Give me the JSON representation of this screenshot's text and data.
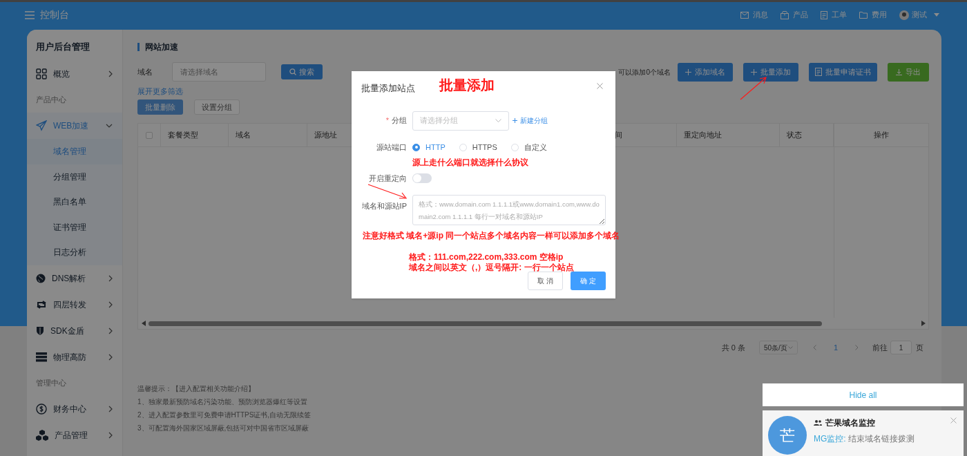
{
  "topbar": {
    "title": "控制台",
    "nav": [
      {
        "label": "消息"
      },
      {
        "label": "产品"
      },
      {
        "label": "工单"
      },
      {
        "label": "费用"
      }
    ],
    "user": "测试"
  },
  "sidebar": {
    "title": "用户后台管理",
    "items": [
      {
        "kind": "item",
        "label": "概览",
        "selected": false
      },
      {
        "kind": "section",
        "label": "产品中心"
      },
      {
        "kind": "item",
        "label": "WEB加速",
        "selected": false,
        "expanded": true,
        "children": [
          {
            "label": "域名管理",
            "selected": true
          },
          {
            "label": "分组管理",
            "selected": false
          },
          {
            "label": "黑白名单",
            "selected": false
          },
          {
            "label": "证书管理",
            "selected": false
          },
          {
            "label": "日志分析",
            "selected": false
          }
        ]
      },
      {
        "kind": "item",
        "label": "DNS解析",
        "selected": false,
        "expanded": false
      },
      {
        "kind": "item",
        "label": "四层转发",
        "selected": false,
        "expanded": false
      },
      {
        "kind": "item",
        "label": "SDK金盾",
        "selected": false,
        "expanded": false
      },
      {
        "kind": "item",
        "label": "物理高防",
        "selected": false,
        "expanded": false
      },
      {
        "kind": "section",
        "label": "管理中心"
      },
      {
        "kind": "item",
        "label": "财务中心",
        "selected": false,
        "expanded": false
      },
      {
        "kind": "item",
        "label": "产品管理",
        "selected": false,
        "expanded": false
      }
    ]
  },
  "page": {
    "title": "网站加速",
    "filter_label": "域名",
    "filter_placeholder": "请选择域名",
    "search_button": "搜索",
    "quota_text": "可以添加0个域名",
    "actions": [
      {
        "label": "添加域名",
        "kind": "add"
      },
      {
        "label": "批量添加",
        "kind": "add"
      },
      {
        "label": "批量申请证书",
        "kind": "doc"
      },
      {
        "label": "导出",
        "kind": "export"
      }
    ],
    "more_filters": "展开更多筛选",
    "bulk_buttons": [
      {
        "label": "批量删除",
        "disabled": true
      },
      {
        "label": "设置分组",
        "disabled": false
      }
    ],
    "table": {
      "select_all_checked": false,
      "columns": [
        "套餐类型",
        "域名",
        "源地址",
        "间",
        "重定向地址",
        "状态",
        "操作"
      ]
    },
    "pagination": {
      "total": "共 0 条",
      "page_size": "50条/页",
      "pages": [
        {
          "label": "1",
          "selected": true
        }
      ],
      "goto_label": "前往",
      "goto_value": "1",
      "goto_suffix": "页"
    },
    "tips": [
      "温馨提示：【进入配置相关功能介绍】",
      "1、独家最新预防域名污染功能、预防浏览器爆红等设置",
      "2、进入配置参数里可免费申请HTTPS证书,自动无限续签",
      "3、可配置海外国家区域屏蔽,包括可对中国省市区域屏蔽"
    ]
  },
  "dialog": {
    "title": "批量添加站点",
    "group_label": "分组",
    "required_mark": "*",
    "group_placeholder": "请选择分组",
    "new_group": "新建分组",
    "port_label": "源站端口",
    "ports": [
      {
        "label": "HTTP",
        "selected": true
      },
      {
        "label": "HTTPS",
        "selected": false
      },
      {
        "label": "自定义",
        "selected": false
      }
    ],
    "redirect_label": "开启重定向",
    "redirect_on": false,
    "domains_label": "域名和源站IP",
    "domains_placeholder": "格式：www.domain.com 1.1.1.1或www.domain1.com,www.domain2.com 1.1.1.1 每行一对域名和源站IP",
    "buttons": [
      {
        "label": "取 消",
        "kind": "secondary"
      },
      {
        "label": "确 定",
        "kind": "primary"
      }
    ]
  },
  "annotations": {
    "heading": "批量添加",
    "port_note": "源上走什么端口就选择什么协议",
    "format_note": "注意好格式 域名+源ip 同一个站点多个域名内容一样可以添加多个域名",
    "example_lines": [
      "格式：111.com,222.com,333.com 空格ip",
      "域名之间以英文（,）逗号隔开: 一行一个站点"
    ]
  },
  "notifications": {
    "hide_all": "Hide all",
    "items": [
      {
        "avatar": "芒",
        "title": "芒果域名监控",
        "source": "MG监控:",
        "message": "结束域名链接拨测"
      }
    ]
  }
}
